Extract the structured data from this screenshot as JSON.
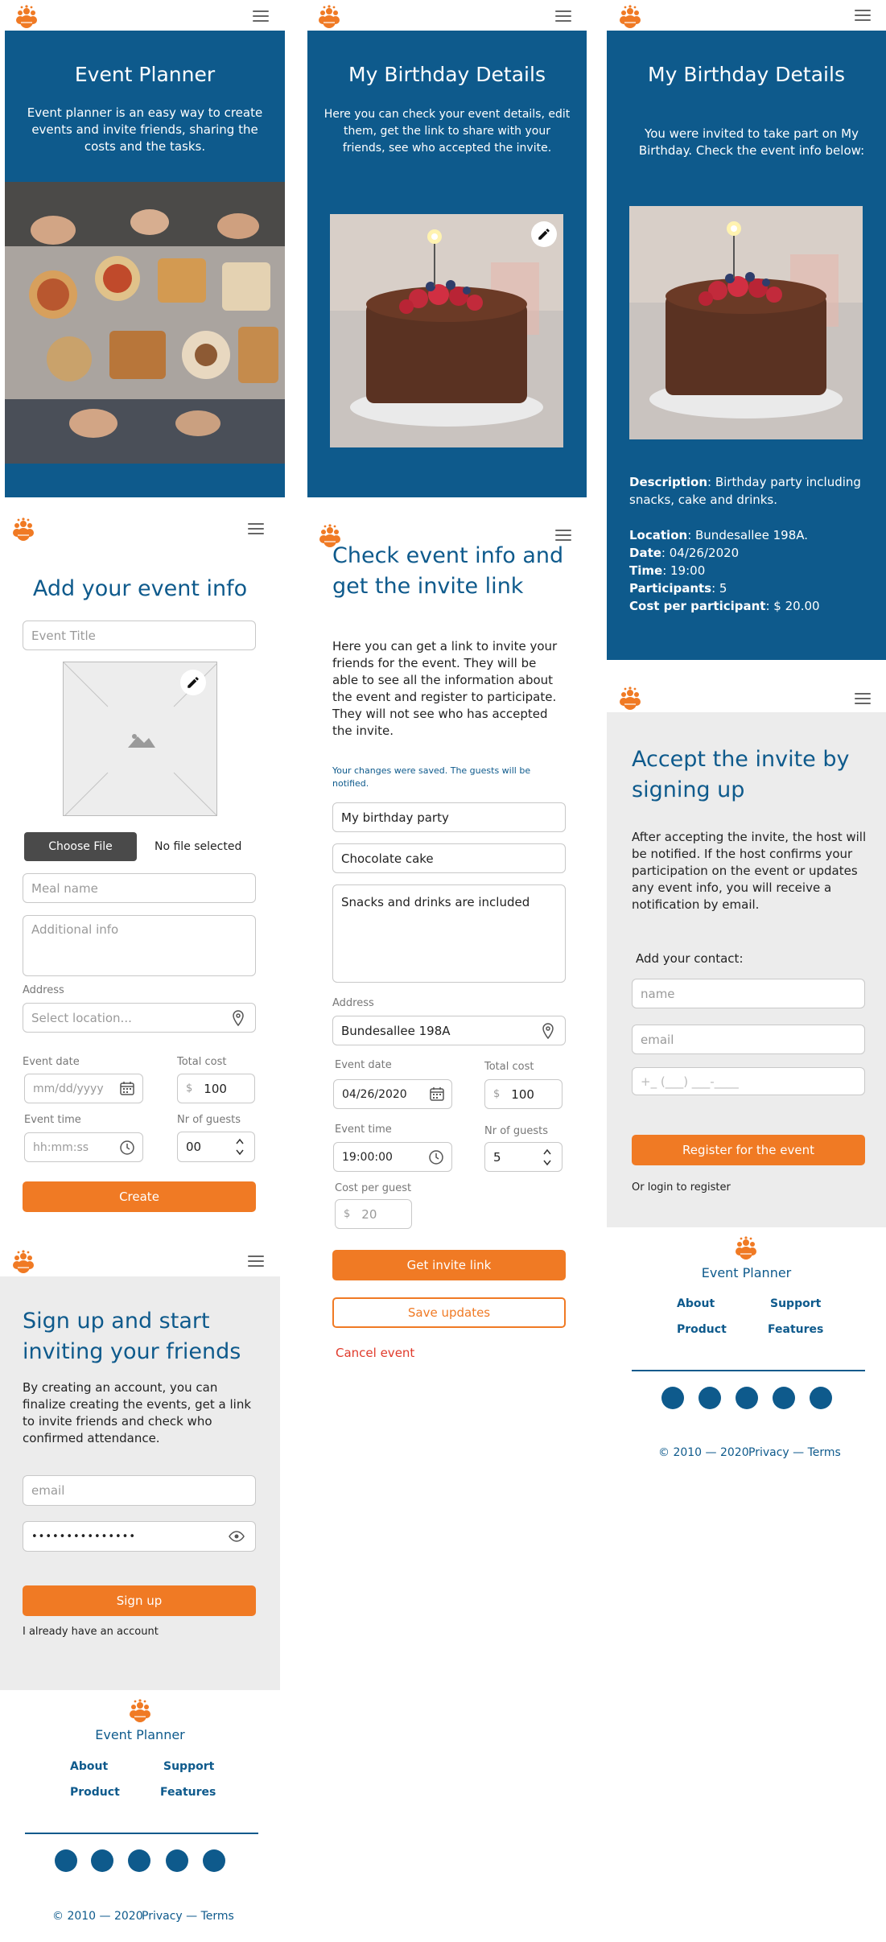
{
  "brand": {
    "name": "Event Planner",
    "accent": "#f07a24",
    "primary": "#0e5a8c",
    "logo_icon": "people-group-icon",
    "menu_icon": "hamburger-menu-icon"
  },
  "screen1": {
    "title": "Event Planner",
    "text": "Event planner is an easy way to create events and invite friends, sharing the costs and the tasks."
  },
  "screen2": {
    "title": "My Birthday Details",
    "text": "Here you can check your event details, edit them, get the link to share with your friends, see who accepted the invite."
  },
  "screen3": {
    "title": "My Birthday Details",
    "text": "You were invited to take part on My Birthday. Check the event info below:",
    "description_label": "Description",
    "description": ": Birthday party including snacks, cake and drinks.",
    "location_label": "Location",
    "location": ": Bundesallee 198A.",
    "date_label": "Date",
    "date": ": 04/26/2020",
    "time_label": "Time",
    "time": ": 19:00",
    "participants_label": "Participants",
    "participants": ": 5",
    "cost_label": "Cost per participant",
    "cost": ": $ 20.00"
  },
  "add_event": {
    "title": "Add your event info",
    "event_title_placeholder": "Event Title",
    "choose_file": "Choose File",
    "no_file": "No file selected",
    "meal_placeholder": "Meal name",
    "additional_placeholder": "Additional info",
    "address_label": "Address",
    "location_placeholder": "Select location...",
    "event_date_label": "Event date",
    "date_placeholder": "mm/dd/yyyy",
    "total_cost_label": "Total cost",
    "currency": "$",
    "total_cost": "100",
    "event_time_label": "Event time",
    "time_placeholder": "hh:mm:ss",
    "guests_label": "Nr of guests",
    "guests": "00",
    "create": "Create"
  },
  "check_event": {
    "title": "Check event info and get the invite link",
    "text": "Here you can get a link to invite your friends for the event. They will be able to see all the information about the event and register to participate. They will not see who has accepted the invite.",
    "saved_notice": "Your changes were saved. The guests will be notified.",
    "event_title": "My birthday party",
    "meal": "Chocolate cake",
    "additional": "Snacks and drinks are included",
    "address_label": "Address",
    "address": "Bundesallee 198A",
    "event_date_label": "Event date",
    "date": "04/26/2020",
    "total_cost_label": "Total cost",
    "currency": "$",
    "total_cost": "100",
    "event_time_label": "Event time",
    "time": "19:00:00",
    "guests_label": "Nr of guests",
    "guests": "5",
    "cost_guest_label": "Cost per guest",
    "cost_guest": "20",
    "get_link": "Get invite link",
    "save_updates": "Save updates",
    "cancel": "Cancel event"
  },
  "signup": {
    "title": "Sign up and start inviting your friends",
    "text": "By creating an account, you can finalize creating the events, get a link to invite friends and check who confirmed attendance.",
    "email_placeholder": "email",
    "password": "•••••••••••••••",
    "button": "Sign up",
    "have_account": "I already have an account"
  },
  "accept": {
    "title": "Accept the invite by signing up",
    "text": "After accepting the invite, the host will be notified. If the host confirms your participation on the event or updates any event info, you will receive a notification by email.",
    "contact_label": "Add your contact:",
    "name_placeholder": "name",
    "email_placeholder": "email",
    "phone_placeholder": "+_ (___) ___-____",
    "button": "Register for the event",
    "login": "Or login to register"
  },
  "footer": {
    "brand": "Event Planner",
    "about": "About",
    "support": "Support",
    "product": "Product",
    "features": "Features",
    "copyright": "© 2010 — 2020",
    "legal": "Privacy — Terms"
  }
}
